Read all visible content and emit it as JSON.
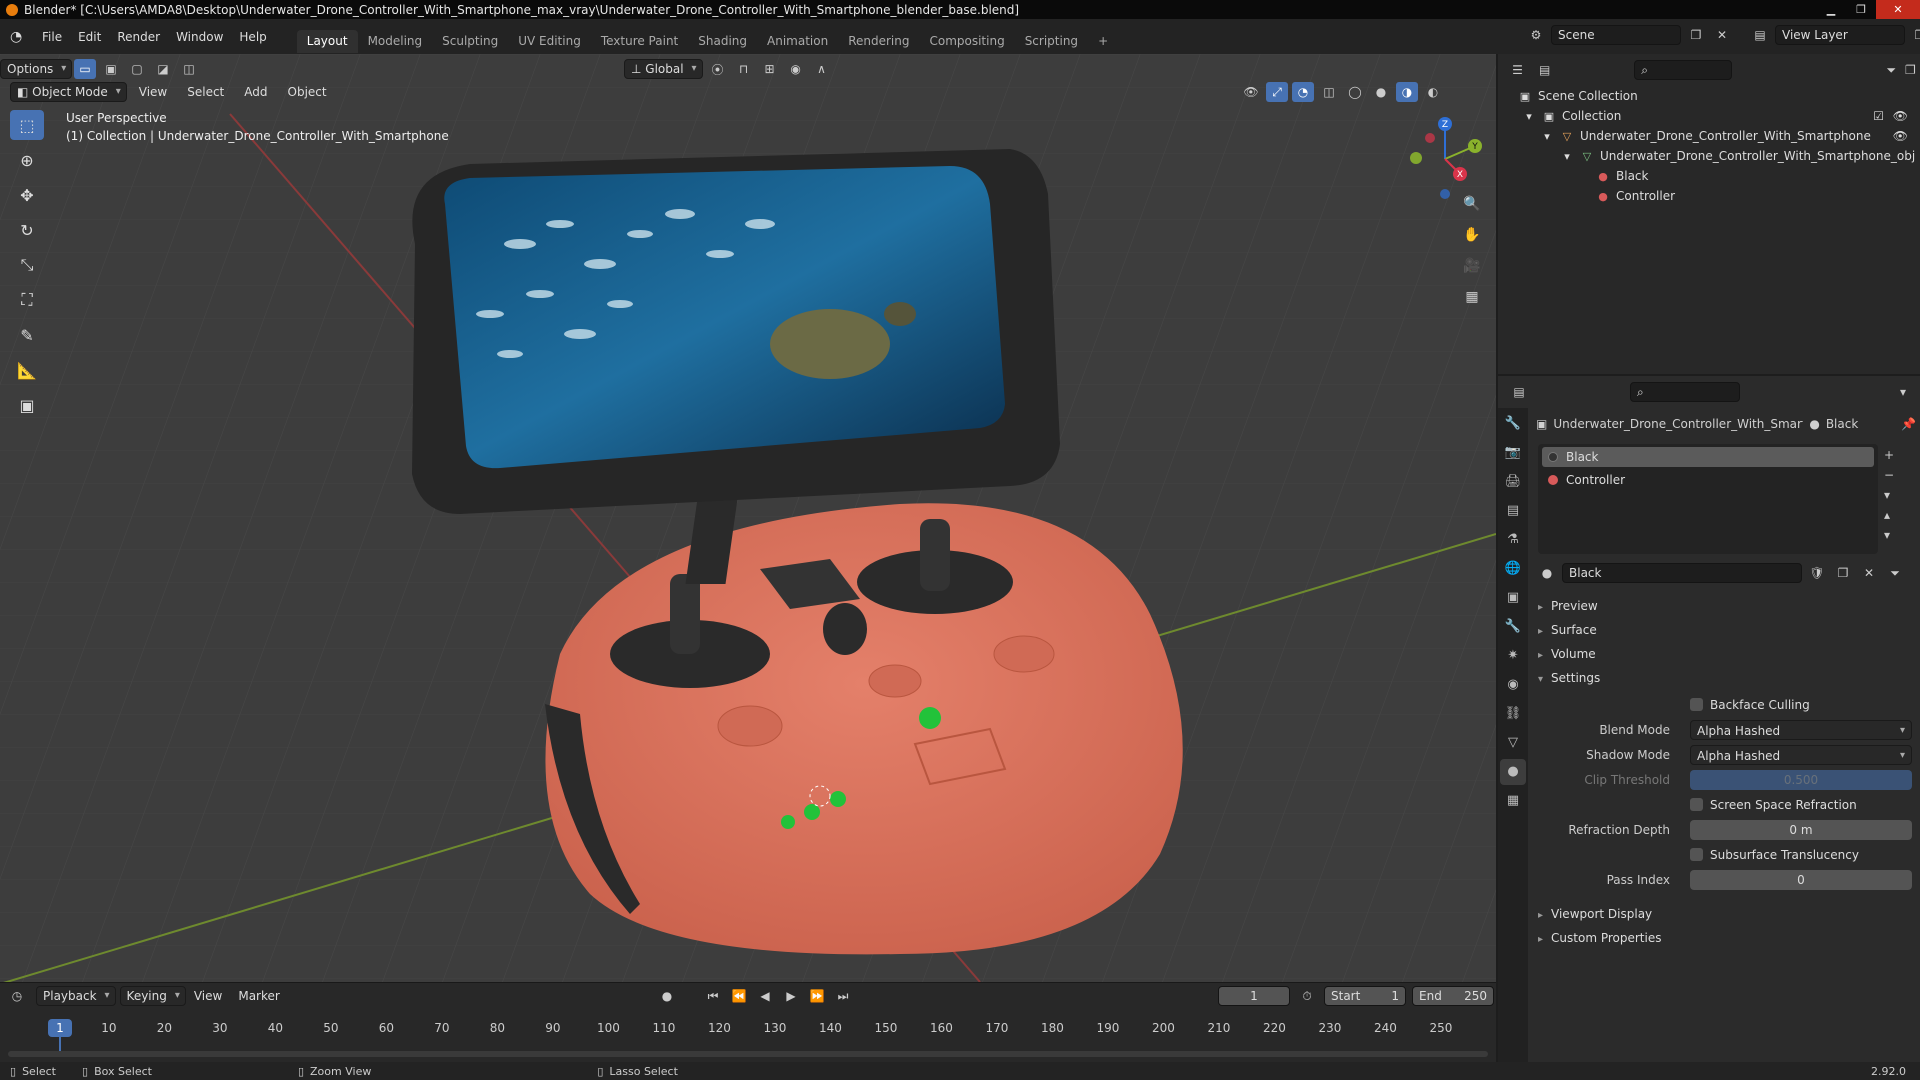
{
  "window": {
    "title": "Blender* [C:\\Users\\AMDA8\\Desktop\\Underwater_Drone_Controller_With_Smartphone_max_vray\\Underwater_Drone_Controller_With_Smartphone_blender_base.blend]"
  },
  "menu": [
    "File",
    "Edit",
    "Render",
    "Window",
    "Help"
  ],
  "workspaces": [
    "Layout",
    "Modeling",
    "Sculpting",
    "UV Editing",
    "Texture Paint",
    "Shading",
    "Animation",
    "Rendering",
    "Compositing",
    "Scripting"
  ],
  "active_workspace": "Layout",
  "scene": {
    "name": "Scene",
    "view_layer": "View Layer"
  },
  "viewport": {
    "mode": "Object Mode",
    "menus": [
      "View",
      "Select",
      "Add",
      "Object"
    ],
    "orientation": "Global",
    "options_label": "Options",
    "info_line1": "User Perspective",
    "info_line2": "(1) Collection | Underwater_Drone_Controller_With_Smartphone"
  },
  "gizmo": {
    "x": "X",
    "y": "Y",
    "z": "Z"
  },
  "outliner": {
    "root": "Scene Collection",
    "collection": "Collection",
    "object": "Underwater_Drone_Controller_With_Smartphone",
    "mesh": "Underwater_Drone_Controller_With_Smartphone_obj",
    "mat1": "Black",
    "mat2": "Controller"
  },
  "properties": {
    "object_name": "Underwater_Drone_Controller_With_Smartpho...",
    "material_name": "Black",
    "slots": [
      "Black",
      "Controller"
    ],
    "datablock": "Black",
    "panels": {
      "preview": "Preview",
      "surface": "Surface",
      "volume": "Volume",
      "settings": "Settings",
      "viewport_display": "Viewport Display",
      "custom_properties": "Custom Properties"
    },
    "backface_culling": "Backface Culling",
    "blend_mode_label": "Blend Mode",
    "blend_mode": "Alpha Hashed",
    "shadow_mode_label": "Shadow Mode",
    "shadow_mode": "Alpha Hashed",
    "clip_threshold_label": "Clip Threshold",
    "clip_threshold": "0.500",
    "ssr": "Screen Space Refraction",
    "refraction_depth_label": "Refraction Depth",
    "refraction_depth": "0 m",
    "subsurface": "Subsurface Translucency",
    "pass_index_label": "Pass Index",
    "pass_index": "0"
  },
  "timeline": {
    "menus": [
      "Playback",
      "Keying",
      "View",
      "Marker"
    ],
    "current_frame": "1",
    "start_label": "Start",
    "start": "1",
    "end_label": "End",
    "end": "250",
    "ticks": [
      "10",
      "20",
      "30",
      "40",
      "50",
      "60",
      "70",
      "80",
      "90",
      "100",
      "110",
      "120",
      "130",
      "140",
      "150",
      "160",
      "170",
      "180",
      "190",
      "200",
      "210",
      "220",
      "230",
      "240",
      "250"
    ]
  },
  "status": {
    "select": "Select",
    "box_select": "Box Select",
    "zoom_view": "Zoom View",
    "lasso_select": "Lasso Select",
    "version": "2.92.0"
  },
  "colors": {
    "accent": "#4772b3",
    "controller": "#d9735e",
    "screen_water": "#1f6fa0",
    "button_green": "#22c23a"
  }
}
